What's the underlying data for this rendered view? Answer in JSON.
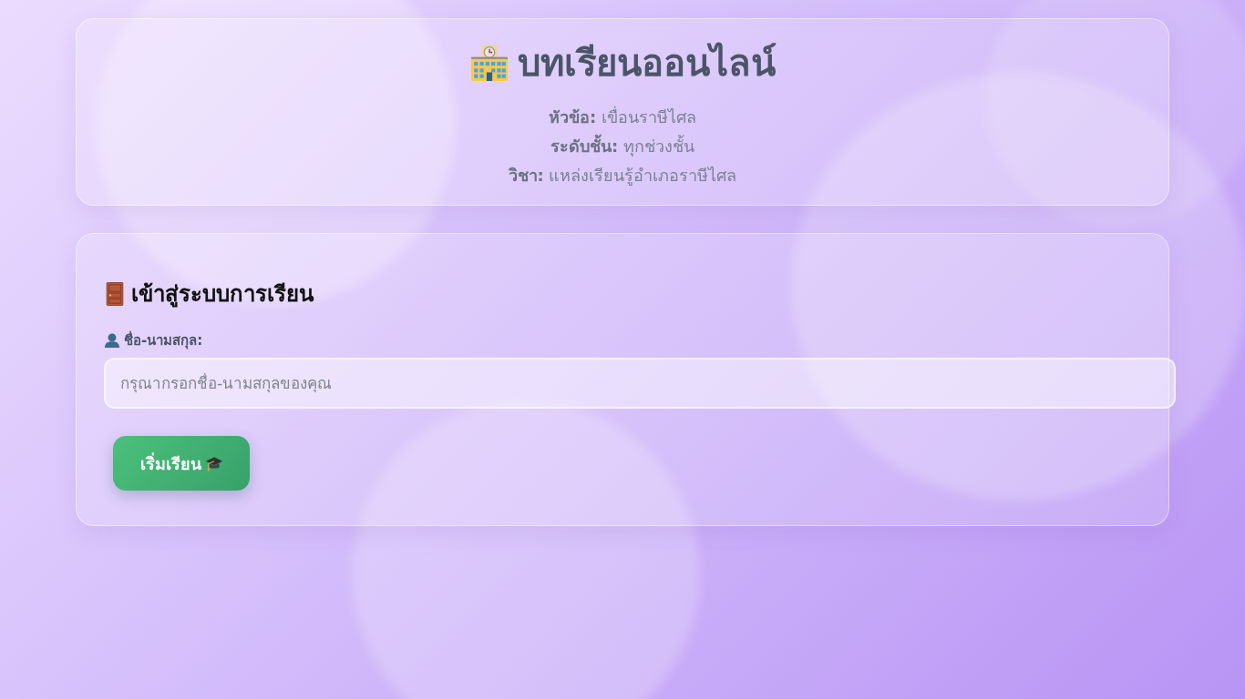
{
  "header": {
    "title": "บทเรียนออนไลน์",
    "details": [
      "**หัวข้อ:** เขื่อนราษีไศล",
      "**ระดับชั้น:** ทุกช่วงชั้น",
      "**วิชา:** แหล่งเรียนรู้อำเภอราษีไศล"
    ]
  },
  "login": {
    "heading": "เข้าสู่ระบบการเรียน",
    "name_field": {
      "label": "ชื่อ-นามสกุล:",
      "placeholder": "กรุณากรอกชื่อ-นามสกุลของคุณ"
    },
    "start_button": {
      "label": "เริ่มเรียน"
    }
  }
}
